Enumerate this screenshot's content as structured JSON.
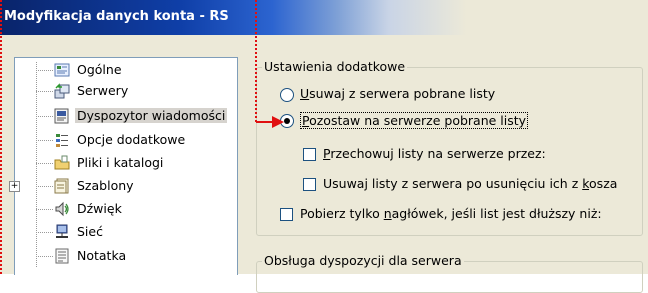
{
  "window": {
    "title": "Modyfikacja danych konta - RS"
  },
  "tree": {
    "items": [
      {
        "label": "Ogólne",
        "icon": "general-icon"
      },
      {
        "label": "Serwery",
        "icon": "servers-icon"
      },
      {
        "label": "Dyspozytor wiadomości",
        "icon": "dispatcher-icon",
        "selected": true
      },
      {
        "label": "Opcje dodatkowe",
        "icon": "options-icon"
      },
      {
        "label": "Pliki i katalogi",
        "icon": "folder-icon"
      },
      {
        "label": "Szablony",
        "icon": "templates-icon",
        "expander": "+"
      },
      {
        "label": "Dźwięk",
        "icon": "sound-icon"
      },
      {
        "label": "Sieć",
        "icon": "network-icon"
      },
      {
        "label": "Notatka",
        "icon": "note-icon"
      }
    ]
  },
  "settings": {
    "group_title": "Ustawienia dodatkowe",
    "radio_remove": {
      "pre": "",
      "u": "U",
      "post": "suwaj z serwera pobrane listy"
    },
    "radio_keep": {
      "pre": "",
      "u": "P",
      "post": "ozostaw na serwerze pobrane listy"
    },
    "check_store": {
      "pre": "",
      "u": "P",
      "post": "rzechowuj listy na serwerze przez:"
    },
    "check_delete_after": {
      "pre": "Usuwaj listy z serwera po usunięciu ich z ",
      "u": "k",
      "post": "osza"
    },
    "check_headers": {
      "pre": "Pobierz tylko ",
      "u": "n",
      "post": "agłówek, jeśli list jest dłuższy niż:"
    },
    "selected_radio": "keep"
  },
  "dispositions": {
    "group_title": "Obsługa dyspozycji dla serwera"
  },
  "colors": {
    "annotation": "#e01010",
    "title_bar_start": "#0a246a",
    "dialog_bg": "#ece9d8"
  }
}
